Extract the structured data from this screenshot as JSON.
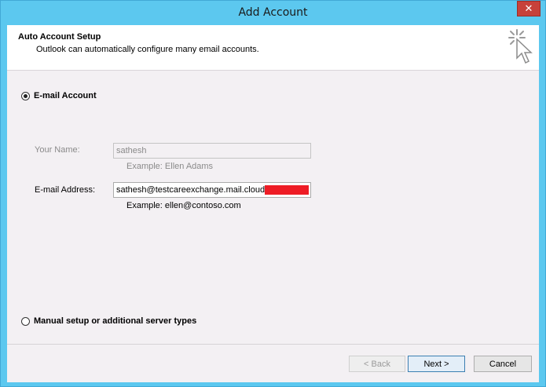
{
  "window": {
    "title": "Add Account",
    "close_glyph": "✕"
  },
  "header": {
    "title": "Auto Account Setup",
    "subtitle": "Outlook can automatically configure many email accounts.",
    "icon": "wizard-cursor-icon"
  },
  "options": {
    "email_account": {
      "label": "E-mail Account",
      "selected": true
    },
    "manual_setup": {
      "label": "Manual setup or additional server types",
      "selected": false
    }
  },
  "form": {
    "name": {
      "label": "Your Name:",
      "value": "sathesh",
      "example": "Example: Ellen Adams"
    },
    "email": {
      "label": "E-mail Address:",
      "value": "sathesh@testcareexchange.mail.cloud",
      "example": "Example: ellen@contoso.com"
    }
  },
  "buttons": {
    "back": "< Back",
    "next": "Next >",
    "cancel": "Cancel"
  },
  "colors": {
    "titlebar": "#5cc8ef",
    "close": "#c7413a",
    "redaction": "#ee1c25"
  }
}
